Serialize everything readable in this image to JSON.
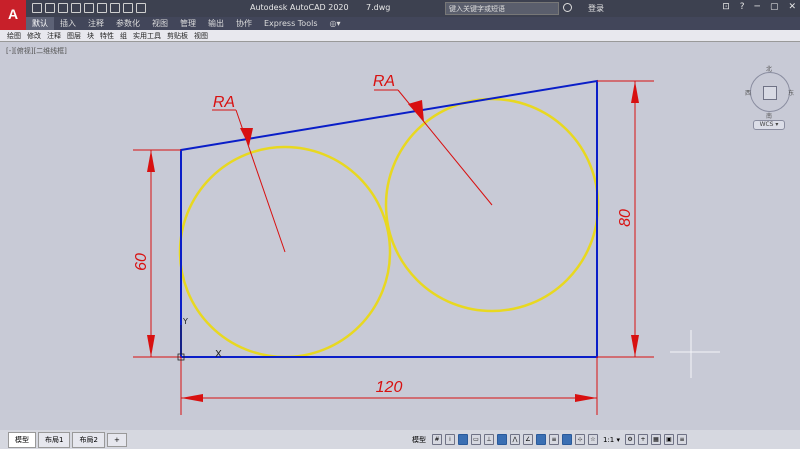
{
  "titlebar": {
    "app_logo": "A",
    "app_name": "Autodesk AutoCAD 2020",
    "file_name": "7.dwg",
    "search_placeholder": "键入关键字或短语",
    "login_label": "登录"
  },
  "ribbon": {
    "tabs": [
      "默认",
      "插入",
      "注释",
      "参数化",
      "视图",
      "管理",
      "输出",
      "协作",
      "Express Tools",
      "◎▾"
    ],
    "active_tab": 0,
    "panels": [
      "绘图",
      "修改",
      "注释",
      "图层",
      "块",
      "特性",
      "组",
      "实用工具",
      "剪贴板",
      "视图"
    ]
  },
  "viewport": {
    "label": "[-][俯视][二维线框]"
  },
  "drawing": {
    "colors": {
      "outline": "#0a1ec8",
      "circle": "#e8d820",
      "dimension": "#d81010",
      "background": "#c8cad6"
    },
    "dimensions": {
      "height_left": "60",
      "height_right": "80",
      "width_bottom": "120",
      "radius_left": "RA",
      "radius_right": "RA"
    },
    "ucs_y_label": "Y",
    "ucs_x_label": "X"
  },
  "viewcube": {
    "north": "北",
    "south": "南",
    "west": "西",
    "east": "东",
    "wcs": "WCS ▾"
  },
  "layout_tabs": [
    "模型",
    "布局1",
    "布局2",
    "+"
  ],
  "status_bar": {
    "model_label": "模型",
    "scale_label": "1:1 ▾"
  }
}
